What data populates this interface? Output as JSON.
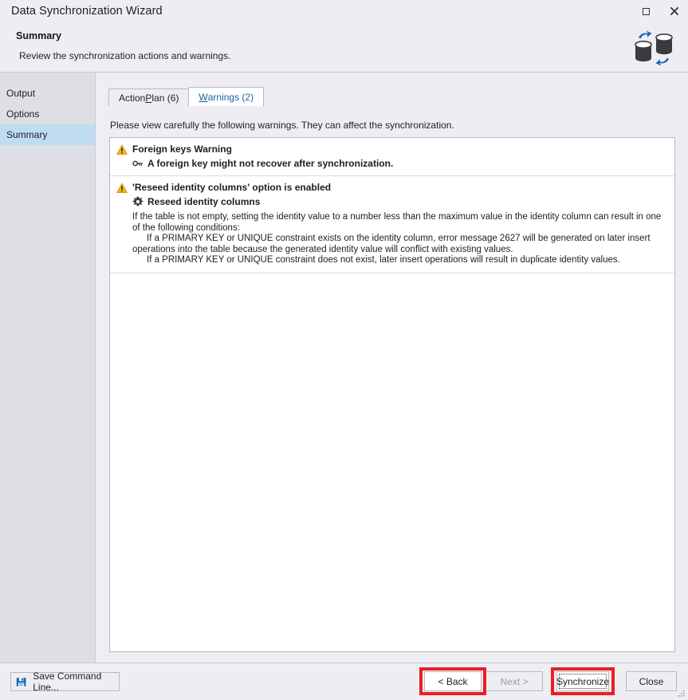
{
  "window": {
    "title": "Data Synchronization Wizard",
    "maximize_label": "Maximize",
    "close_label": "Close",
    "icon": "database-sync-icon"
  },
  "header": {
    "title": "Summary",
    "subtitle": "Review the synchronization actions and warnings.",
    "icon": "database-sync-icon"
  },
  "sidebar": {
    "items": [
      {
        "label": "Output",
        "selected": false
      },
      {
        "label": "Options",
        "selected": false
      },
      {
        "label": "Summary",
        "selected": true
      }
    ],
    "selected_bg": "#c0dcf3"
  },
  "main": {
    "tabs": [
      {
        "label": "Action Plan (6)",
        "accel_before": "Action ",
        "accel": "P",
        "accel_after": "lan (6)",
        "active": false
      },
      {
        "label": "Warnings (2)",
        "accel_before": "",
        "accel": "W",
        "accel_after": "arnings (2)",
        "active": true
      }
    ],
    "instructions": "Please view carefully the following warnings. They can affect the synchronization.",
    "warnings": [
      {
        "icon": "warning-triangle-icon",
        "title": "Foreign keys Warning",
        "detail_icon": "key-icon",
        "detail_title": "A foreign key might not recover after synchronization.",
        "body": []
      },
      {
        "icon": "warning-triangle-icon",
        "title": "'Reseed identity columns' option is enabled",
        "detail_icon": "gear-icon",
        "detail_title": "Reseed identity columns",
        "body": [
          {
            "text": "If the table is not empty, setting the identity value to a number less than the maximum value in the identity column can result in one of the following conditions:",
            "indent": false
          },
          {
            "text": "If a PRIMARY KEY or UNIQUE constraint exists on the identity column, error message 2627 will be generated on later insert operations into the table because the generated identity value will conflict with existing values.",
            "indent": true
          },
          {
            "text": "If a PRIMARY KEY or UNIQUE constraint does not exist, later insert operations will result in duplicate identity values.",
            "indent": true
          }
        ]
      }
    ]
  },
  "footer": {
    "save_command_line": "Save Command Line...",
    "save_icon": "floppy-save-icon",
    "back": "< Back",
    "next": "Next >",
    "next_disabled": true,
    "synchronize": "Synchronize",
    "synchronize_focused": true,
    "close": "Close"
  },
  "annotations": {
    "color": "#ed1c24",
    "highlighted_buttons": [
      "< Back",
      "Synchronize"
    ]
  },
  "colors": {
    "window_bg": "#eeeef2",
    "sidebar_bg": "#dedfe4",
    "panel_bg": "#ffffff",
    "border": "#b9b9c6",
    "accent_link": "#1560a8",
    "warning_amber": "#f5b50a",
    "annotation_red": "#ed1c24"
  }
}
